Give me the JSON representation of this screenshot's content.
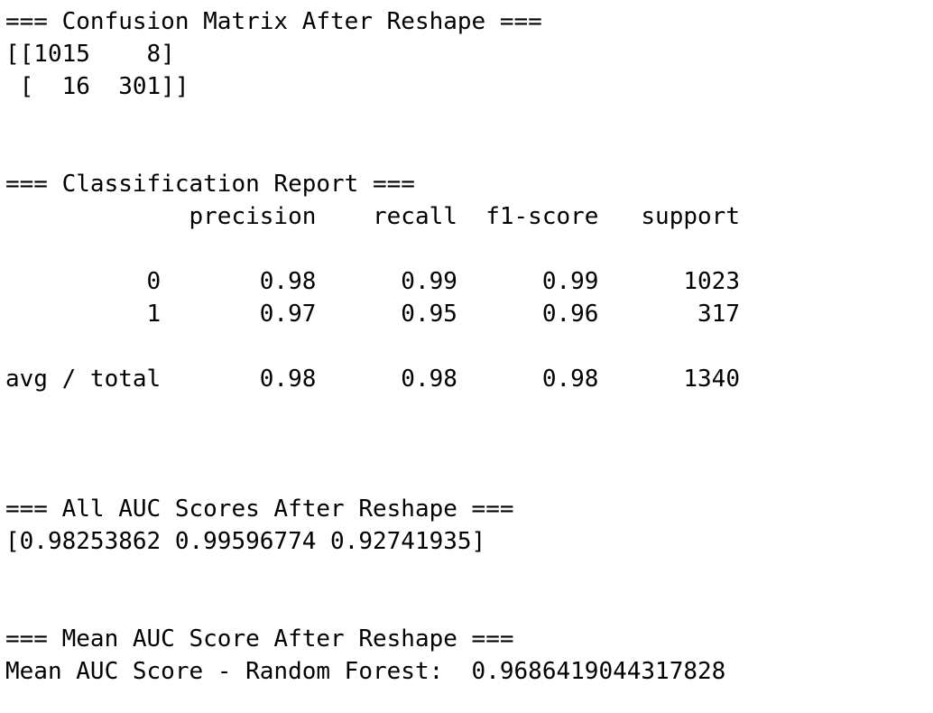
{
  "confusion": {
    "header": "=== Confusion Matrix After Reshape ===",
    "row1": "[[1015    8]",
    "row2": " [  16  301]]"
  },
  "report": {
    "header": "=== Classification Report ===",
    "columns": "             precision    recall  f1-score   support",
    "rows": [
      "          0       0.98      0.99      0.99      1023",
      "          1       0.97      0.95      0.96       317"
    ],
    "total": "avg / total       0.98      0.98      0.98      1340"
  },
  "auc_all": {
    "header": "=== All AUC Scores After Reshape ===",
    "values": "[0.98253862 0.99596774 0.92741935]"
  },
  "auc_mean": {
    "header": "=== Mean AUC Score After Reshape ===",
    "value_line": "Mean AUC Score - Random Forest:  0.9686419044317828"
  }
}
